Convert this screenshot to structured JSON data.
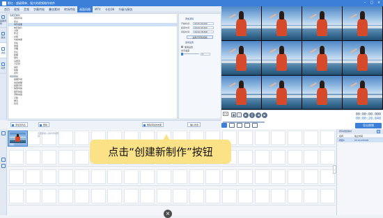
{
  "app": {
    "title": "影忆 - 超级简单、强大的视频制作软件"
  },
  "menu": {
    "items": [
      {
        "label": "首页"
      },
      {
        "label": "视频"
      },
      {
        "label": "音频"
      },
      {
        "label": "字幕特效"
      },
      {
        "label": "叠加素材"
      },
      {
        "label": "转场特效"
      },
      {
        "label": "画面风格"
      },
      {
        "label": "MTV"
      },
      {
        "label": "卡拉OK"
      },
      {
        "label": "升级与服务"
      }
    ],
    "active_index": 6
  },
  "left_rail": {
    "items": [
      {
        "label": "画面调整"
      },
      {
        "label": "美化"
      },
      {
        "label": "滤镜"
      },
      {
        "label": "动景"
      }
    ],
    "active_index": 2
  },
  "effect_list": {
    "groups": [
      {
        "title": "性能定制化",
        "items": [
          "滤镜抖动",
          "复古",
          "电影画面",
          "电影胶片",
          "分屏",
          "怀旧",
          "光照",
          "均衡效果",
          "手绘",
          "素描",
          "浮雕",
          "霓虹",
          "模糊",
          "锐化",
          "马赛克",
          "万花筒",
          "倒影",
          "镜像",
          "虚化"
        ]
      },
      {
        "title": "动态特效",
        "items": [
          "画面抖动",
          "动感模糊",
          "画面闪烁",
          "缩放动画",
          "旋转动画",
          "漂移动画",
          "平移",
          "推近",
          "拉远"
        ]
      }
    ],
    "selected_item": "电影画面"
  },
  "props": {
    "section1_title": "添加滤镜",
    "start_label": "开始时间:",
    "start_value": "00:00:00.000",
    "end_label": "结束时间:",
    "end_value": "00:00:00.000",
    "duration_label": "持续时间:",
    "duration_value": "00:00:28.848",
    "apply_button": "适用于所有视频",
    "section2_title": "运动设置",
    "check_label": "使用设置",
    "slider_label": "水平速度",
    "slider_value": 0,
    "slider_text": "0"
  },
  "bottom_toolbar": {
    "add_button": "添加到列表",
    "delete_button": "删除",
    "remove_all_button": "删除添加的效果",
    "confirm_button": "确认修改"
  },
  "player": {
    "time_box": "1/4",
    "play_icon": "play-icon",
    "current_time": "00:00:00.000",
    "total_time": "00:00:28.848",
    "progress_fraction": 0.0
  },
  "export_button": "导出视频",
  "timeline": {
    "clip_label": "视频",
    "hint_text": "双击或拖入素材添加视频"
  },
  "right_panel": {
    "title": "所有视频素材",
    "col_name": "名称",
    "col_time": "截止时间",
    "row_name": "视频1",
    "row_time": "00:00:28.848"
  },
  "tip": {
    "text": "点击“创建新制作”按钮"
  },
  "colors": {
    "accent": "#3b7fd8",
    "tip_bg": "#fbe287"
  }
}
